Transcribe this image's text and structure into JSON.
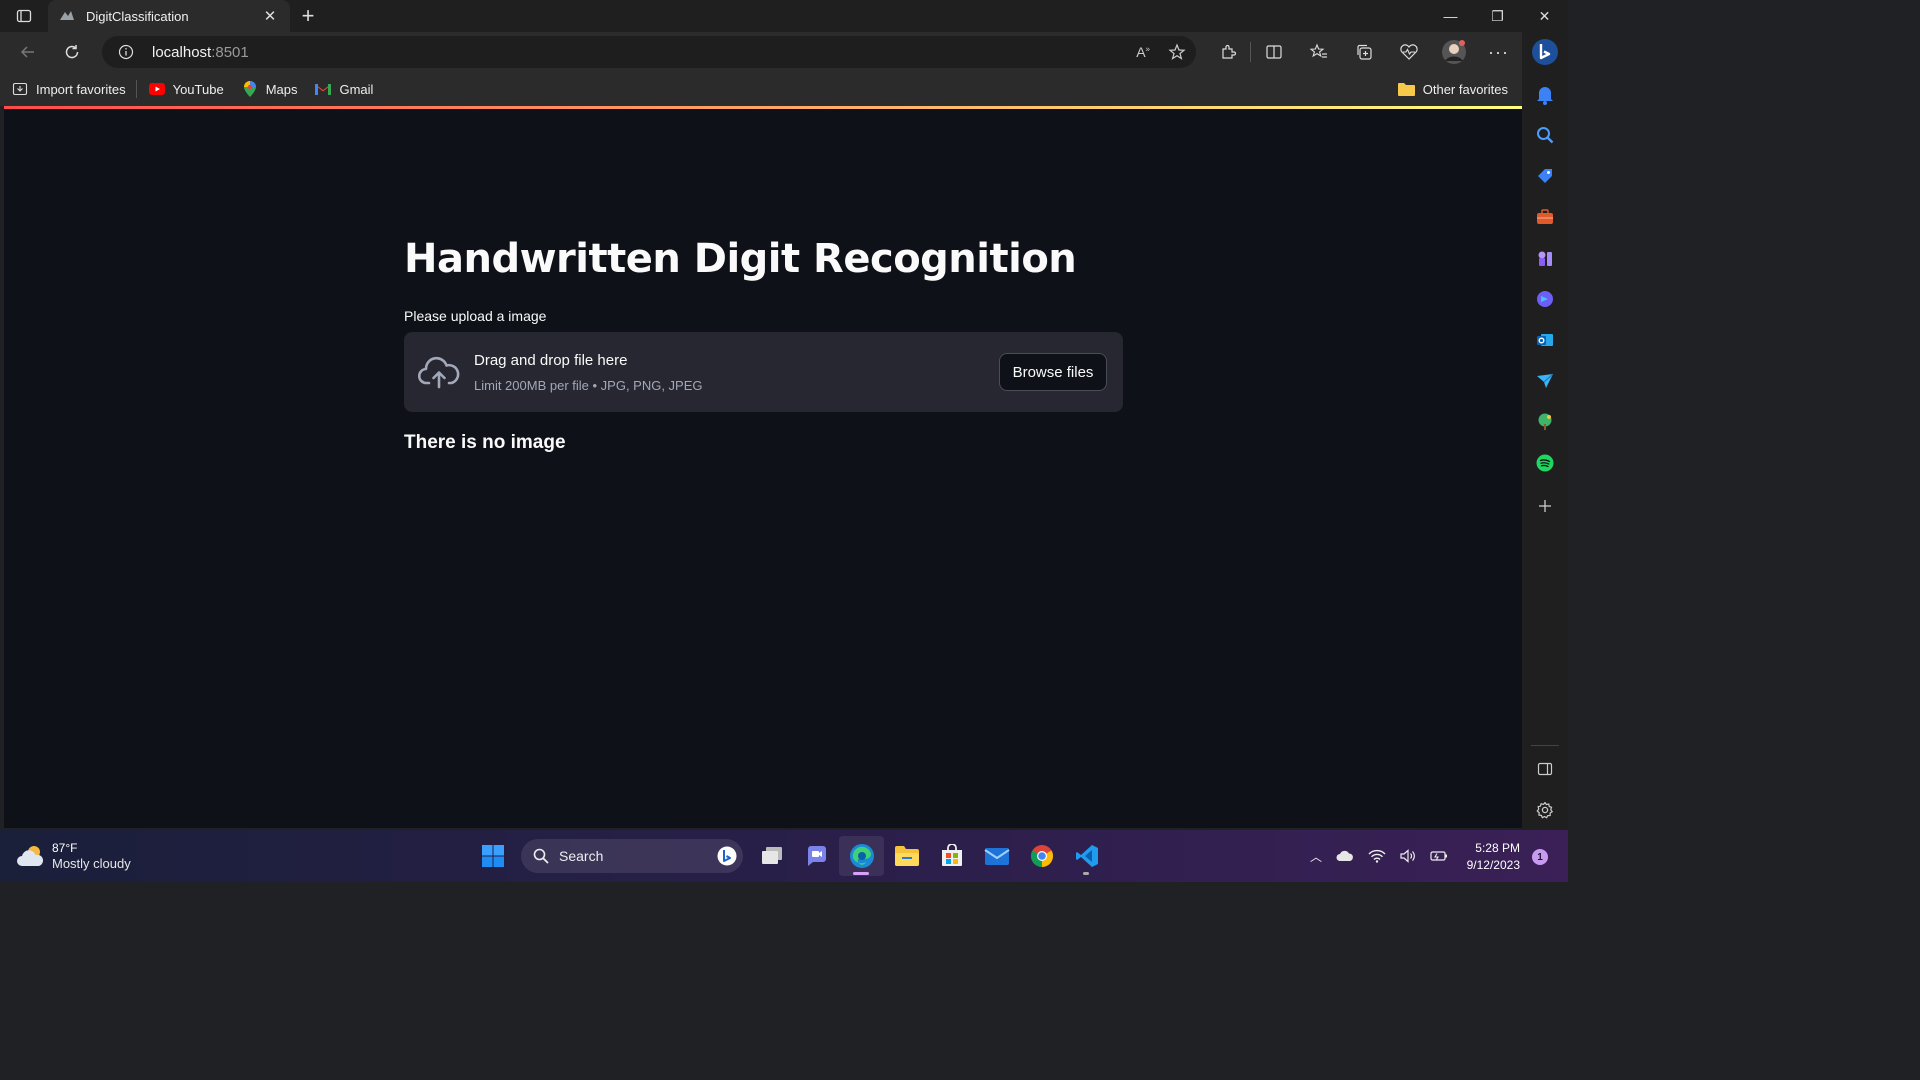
{
  "browser": {
    "tab_title": "DigitClassification",
    "url_host": "localhost",
    "url_port": ":8501",
    "bookmarks": [
      {
        "label": "Import favorites",
        "icon": "import-icon"
      },
      {
        "label": "YouTube",
        "icon": "youtube-icon"
      },
      {
        "label": "Maps",
        "icon": "maps-icon"
      },
      {
        "label": "Gmail",
        "icon": "gmail-icon"
      }
    ],
    "other_favorites": "Other favorites"
  },
  "app": {
    "title": "Handwritten Digit Recognition",
    "upload_label": "Please upload a image",
    "dropzone_title": "Drag and drop file here",
    "dropzone_limit": "Limit 200MB per file • JPG, PNG, JPEG",
    "browse_button": "Browse files",
    "status_message": "There is no image",
    "accent_gradient": [
      "#ff4b4b",
      "#fffd80"
    ],
    "background": "#0e1117"
  },
  "taskbar": {
    "weather_temp": "87°F",
    "weather_condition": "Mostly cloudy",
    "search_placeholder": "Search",
    "time": "5:28 PM",
    "date": "9/12/2023",
    "notification_count": "1"
  }
}
